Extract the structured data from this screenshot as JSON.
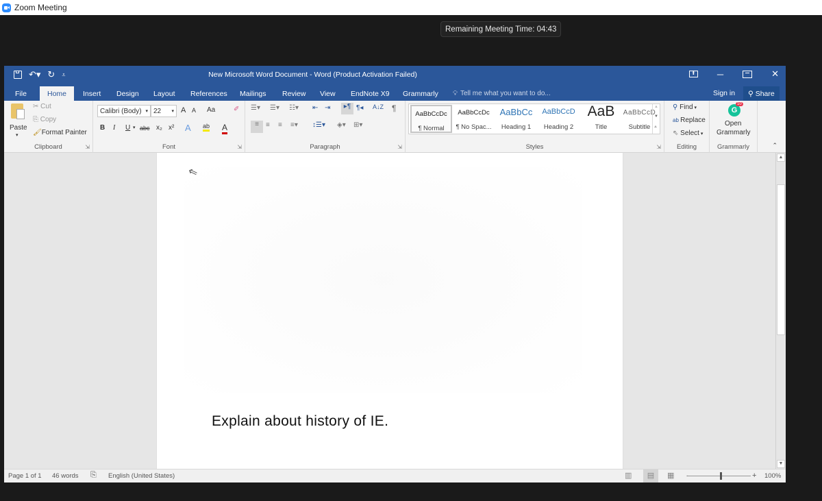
{
  "zoom": {
    "window_title": "Zoom Meeting",
    "timer_label": "Remaining Meeting Time:",
    "timer_value": "04:43"
  },
  "word": {
    "document_title": "New Microsoft Word Document - Word (Product Activation Failed)",
    "qat": {
      "save": "save-icon",
      "undo": "undo-icon",
      "redo": "redo-icon",
      "customize": "customize-icon"
    },
    "window_controls": {
      "ribbon_display": "ribbon-display-icon",
      "minimize": "─",
      "restore": "restore-icon",
      "close": "✕"
    },
    "tabs": [
      {
        "label": "File",
        "active": false
      },
      {
        "label": "Home",
        "active": true
      },
      {
        "label": "Insert",
        "active": false
      },
      {
        "label": "Design",
        "active": false
      },
      {
        "label": "Layout",
        "active": false
      },
      {
        "label": "References",
        "active": false
      },
      {
        "label": "Mailings",
        "active": false
      },
      {
        "label": "Review",
        "active": false
      },
      {
        "label": "View",
        "active": false
      },
      {
        "label": "EndNote X9",
        "active": false
      },
      {
        "label": "Grammarly",
        "active": false
      }
    ],
    "tell_me_placeholder": "Tell me what you want to do...",
    "sign_in": "Sign in",
    "share": "Share",
    "ribbon": {
      "clipboard": {
        "label": "Clipboard",
        "paste": "Paste",
        "cut": "Cut",
        "copy": "Copy",
        "format_painter": "Format Painter"
      },
      "font": {
        "label": "Font",
        "font_name": "Calibri (Body)",
        "font_size": "22",
        "grow": "A",
        "shrink": "A",
        "change_case": "Aa",
        "bold": "B",
        "italic": "I",
        "underline": "U",
        "strikethrough": "abc",
        "subscript": "x₂",
        "superscript": "x²",
        "text_effects": "A",
        "highlight": "ab",
        "font_color": "A",
        "highlight_color": "#f4e900",
        "font_color_value": "#d00000"
      },
      "paragraph": {
        "label": "Paragraph",
        "sort": "A↓Z",
        "pilcrow": "¶"
      },
      "styles": {
        "label": "Styles",
        "items": [
          {
            "sample": "AaBbCcDc",
            "name": "¶ Normal",
            "selected": true
          },
          {
            "sample": "AaBbCcDc",
            "name": "¶ No Spac...",
            "selected": false
          },
          {
            "sample": "AaBbCc",
            "name": "Heading 1",
            "selected": false
          },
          {
            "sample": "AaBbCcD",
            "name": "Heading 2",
            "selected": false
          },
          {
            "sample": "AaB",
            "name": "Title",
            "selected": false
          },
          {
            "sample": "AaBbCcD",
            "name": "Subtitle",
            "selected": false
          }
        ]
      },
      "editing": {
        "label": "Editing",
        "find": "Find",
        "replace": "Replace",
        "select": "Select"
      },
      "grammarly": {
        "label": "Grammarly",
        "open_line1": "Open",
        "open_line2": "Grammarly",
        "badge": "10",
        "brand_color": "#15c39a"
      }
    },
    "document": {
      "text": "Explain about history of IE."
    },
    "status": {
      "page": "Page 1 of 1",
      "words": "46 words",
      "language": "English (United States)",
      "zoom_level": "100%",
      "zoom_minus": "-",
      "zoom_plus": "+"
    },
    "scroll_position": 0.0,
    "colors": {
      "accent": "#2b579a",
      "ribbon_bg": "#f3f3f3"
    }
  }
}
